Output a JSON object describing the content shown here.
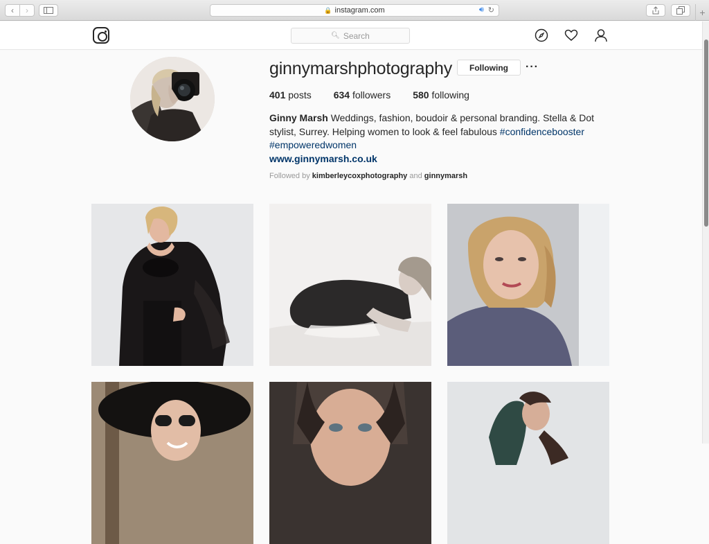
{
  "browser": {
    "url": "instagram.com",
    "plus_label": "+"
  },
  "header": {
    "search_placeholder": "Search"
  },
  "profile": {
    "username": "ginnymarshphotography",
    "follow_button": "Following",
    "more_button": "···",
    "stats": [
      {
        "count": "401",
        "label": "posts"
      },
      {
        "count": "634",
        "label": "followers"
      },
      {
        "count": "580",
        "label": "following"
      }
    ],
    "bio": {
      "name": "Ginny Marsh",
      "text": "Weddings, fashion, boudoir & personal branding. Stella & Dot stylist, Surrey. Helping women to look & feel fabulous",
      "hashtag1": "#confidencebooster",
      "hashtag2": "#empoweredwomen",
      "website": "www.ginnymarsh.co.uk"
    },
    "followed_by": {
      "prefix": "Followed by",
      "user1": "kimberleycoxphotography",
      "and": "and",
      "user2": "ginnymarsh"
    }
  },
  "posts": [
    {
      "subject": "woman in black lace robe"
    },
    {
      "subject": "black and white woman lying on fur"
    },
    {
      "subject": "woman with blonde curls portrait"
    },
    {
      "subject": "woman with black hat and sunglasses"
    },
    {
      "subject": "woman with dark hair close-up"
    },
    {
      "subject": "woman with arms raised"
    }
  ]
}
